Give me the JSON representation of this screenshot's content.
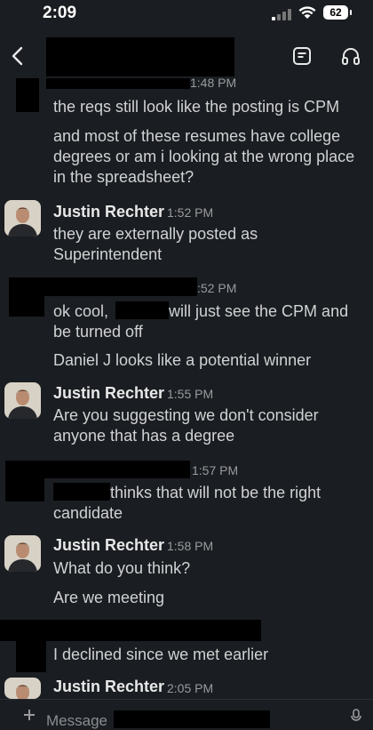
{
  "status_bar": {
    "time": "2:09",
    "battery": "62"
  },
  "header": {
    "back_icon": "chevron-left-icon",
    "canvas_icon": "canvas-icon",
    "huddle_icon": "headphones-icon"
  },
  "messages": [
    {
      "time": "1:48 PM",
      "lines": [
        "the reqs still look like the posting is CPM",
        "and most of these resumes have college degrees or am i looking at the wrong place in the spreadsheet?"
      ]
    },
    {
      "name": "Justin Rechter",
      "time": "1:52 PM",
      "lines": [
        "they are externally posted as Superintendent"
      ]
    },
    {
      "time": ":52 PM",
      "line1a": "ok cool, ",
      "line1b": "will just see the CPM and",
      "line1c": "be turned off",
      "line2": "Daniel J looks like a potential winner"
    },
    {
      "name": "Justin Rechter",
      "time": "1:55 PM",
      "lines": [
        "Are you suggesting we don't consider anyone that has a degree"
      ]
    },
    {
      "time": "1:57 PM",
      "line1": "thinks that will not be the right",
      "line2": "candidate"
    },
    {
      "name": "Justin Rechter",
      "time": "1:58 PM",
      "lines": [
        "What do you think?",
        "Are we meeting"
      ]
    },
    {
      "lines": [
        "I declined since we met earlier"
      ]
    },
    {
      "name": "Justin Rechter",
      "time": "2:05 PM"
    }
  ],
  "composer": {
    "placeholder": "Message"
  },
  "colors": {
    "background": "#1a1d21",
    "text": "#d1d2d3",
    "muted": "#9a9b9d",
    "name": "#e8e8e8"
  }
}
